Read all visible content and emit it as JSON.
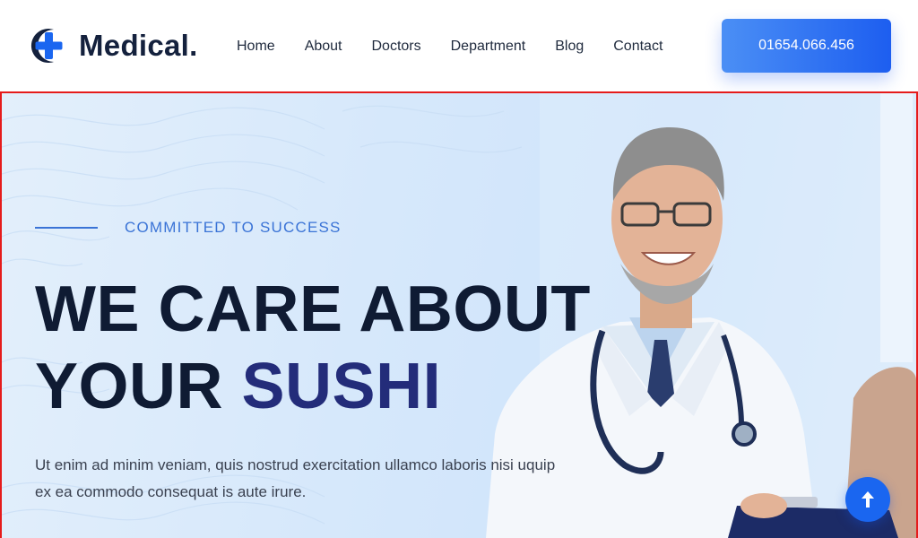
{
  "brand": {
    "name": "Medical.",
    "logo_icon": "medical-cross-logo-icon",
    "accent": "#1a66f0"
  },
  "nav": {
    "items": [
      {
        "label": "Home"
      },
      {
        "label": "About"
      },
      {
        "label": "Doctors"
      },
      {
        "label": "Department"
      },
      {
        "label": "Blog"
      },
      {
        "label": "Contact"
      }
    ]
  },
  "header": {
    "phone_button": "01654.066.456"
  },
  "hero": {
    "tagline": "COMMITTED TO SUCCESS",
    "headline_line1": "WE CARE ABOUT",
    "headline_line2_prefix": "YOUR ",
    "headline_line2_accent": "SUSHI",
    "description_line1": "Ut enim ad minim veniam, quis nostrud exercitation ullamco laboris nisi uquip",
    "description_line2": "ex ea commodo consequat is aute irure."
  },
  "scroll_top": {
    "icon": "arrow-up-icon"
  }
}
